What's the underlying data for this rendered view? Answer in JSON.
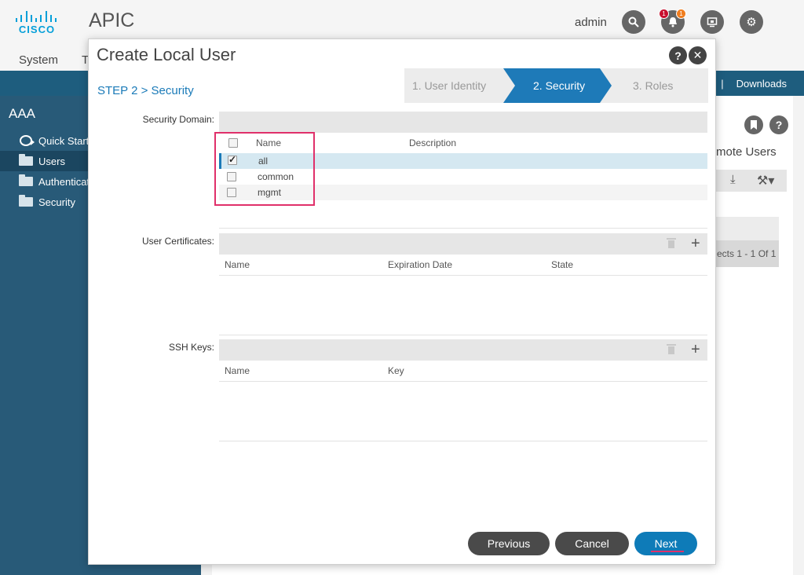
{
  "app": {
    "logo_text": "CISCO",
    "title": "APIC",
    "user": "admin",
    "notification_badges": [
      "1",
      "1"
    ],
    "colors": {
      "brand": "#049fd9",
      "accent": "#1e7ab8",
      "highlight": "#e0306a"
    }
  },
  "nav": {
    "tabs": [
      "System",
      "T"
    ],
    "right_links": {
      "separator": "|",
      "downloads": "Downloads"
    }
  },
  "sidebar": {
    "title": "AAA",
    "items": [
      {
        "label": "Quick Start",
        "icon": "quick-start-icon"
      },
      {
        "label": "Users",
        "icon": "folder-icon",
        "active": true
      },
      {
        "label": "Authenticati",
        "icon": "folder-icon"
      },
      {
        "label": "Security",
        "icon": "folder-icon"
      }
    ]
  },
  "background_panel": {
    "heading": "mote Users",
    "pager_text": "ects 1 - 1 Of 1"
  },
  "modal": {
    "title": "Create Local User",
    "step_label": "STEP 2 > Security",
    "wizard_steps": [
      {
        "label": "1. User Identity",
        "state": "done"
      },
      {
        "label": "2. Security",
        "state": "active"
      },
      {
        "label": "3. Roles",
        "state": "pending"
      }
    ],
    "security_domain": {
      "label": "Security Domain:",
      "columns": [
        "Name",
        "Description"
      ],
      "rows": [
        {
          "name": "all",
          "checked": true
        },
        {
          "name": "common",
          "checked": false
        },
        {
          "name": "mgmt",
          "checked": false
        }
      ]
    },
    "user_certificates": {
      "label": "User Certificates:",
      "columns": [
        "Name",
        "Expiration Date",
        "State"
      ]
    },
    "ssh_keys": {
      "label": "SSH Keys:",
      "columns": [
        "Name",
        "Key"
      ]
    },
    "buttons": {
      "previous": "Previous",
      "cancel": "Cancel",
      "next": "Next"
    }
  }
}
